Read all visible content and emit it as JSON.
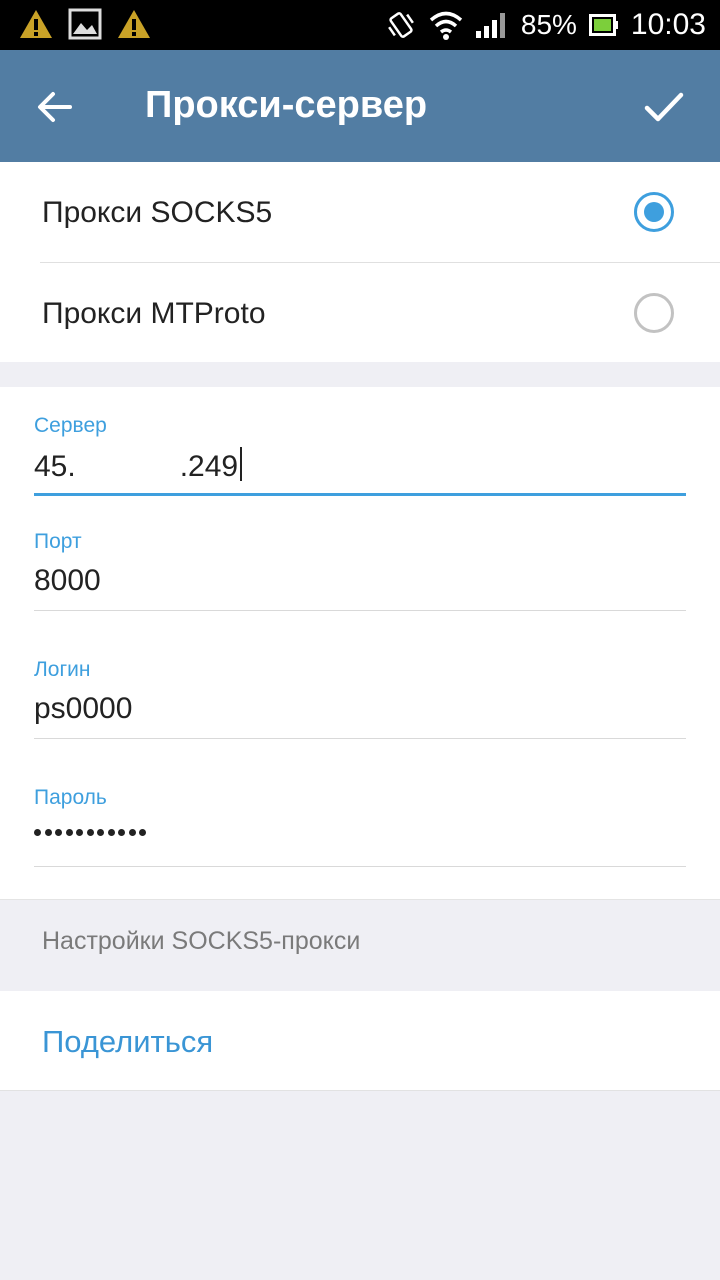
{
  "status_bar": {
    "battery": "85%",
    "time": "10:03",
    "icons": [
      "warning-icon",
      "image-icon",
      "warning-icon",
      "vibrate-icon",
      "wifi-icon",
      "signal-icon",
      "battery-icon"
    ]
  },
  "action_bar": {
    "title": "Прокси-сервер",
    "back_icon": "arrow-left-icon",
    "done_icon": "checkmark-icon",
    "color": "#527da3"
  },
  "proxy_types": [
    {
      "label": "Прокси SOCKS5",
      "selected": true
    },
    {
      "label": "Прокси MTProto",
      "selected": false
    }
  ],
  "fields": {
    "server": {
      "label": "Сервер",
      "value_start": "45.",
      "value_end": ".249"
    },
    "port": {
      "label": "Порт",
      "value": "8000"
    },
    "login": {
      "label": "Логин",
      "value": "ps0000"
    },
    "password": {
      "label": "Пароль",
      "masked_length": 11
    }
  },
  "hint": "Настройки SOCKS5-прокси",
  "share": {
    "label": "Поделиться"
  },
  "colors": {
    "accent": "#3e9fde",
    "toolbar": "#527da3",
    "background": "#efeff4"
  }
}
